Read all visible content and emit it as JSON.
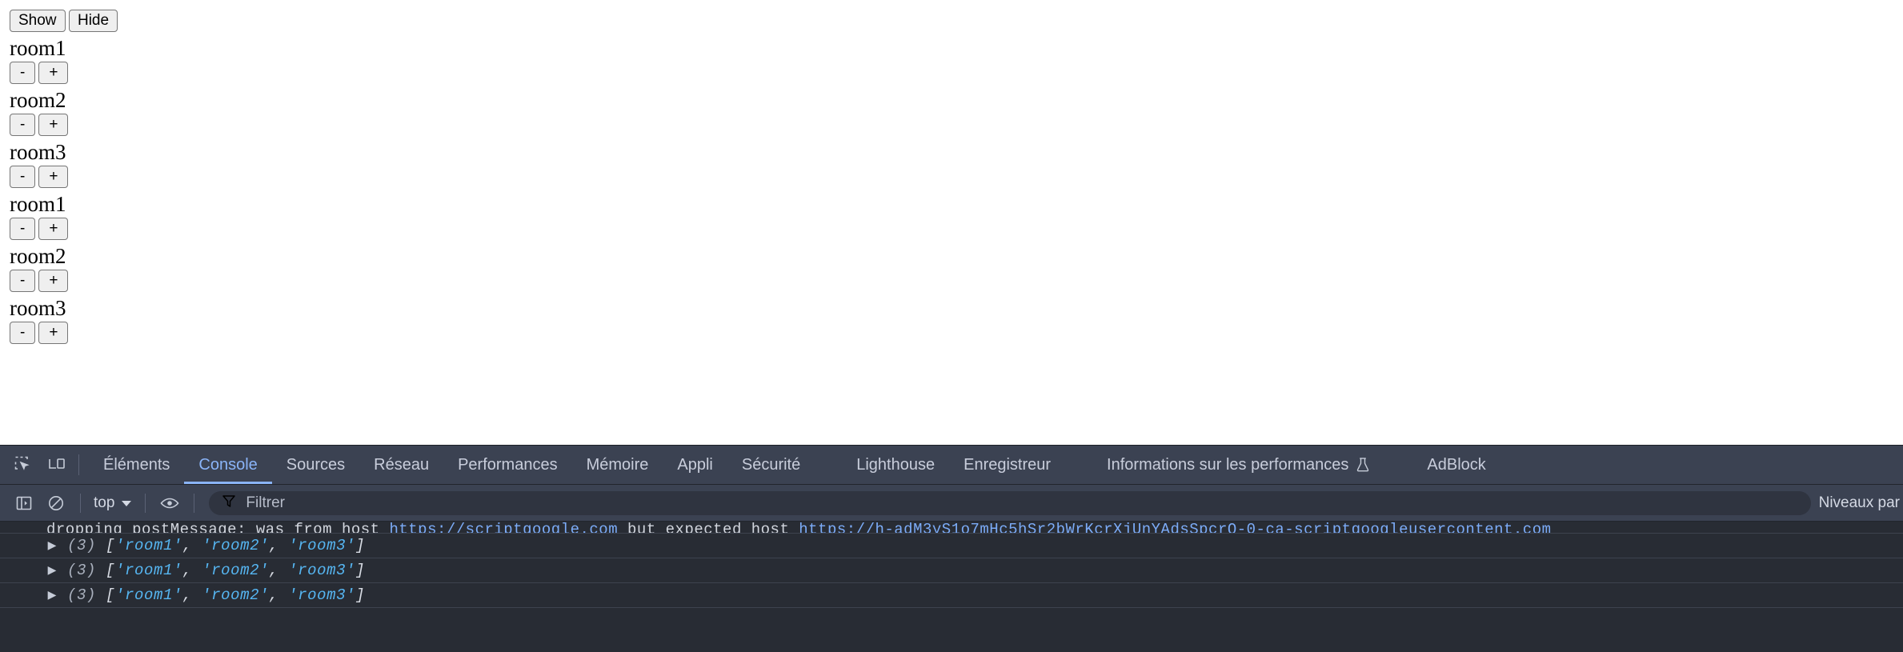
{
  "page": {
    "top_buttons": [
      {
        "label": "Show",
        "name": "show-button"
      },
      {
        "label": "Hide",
        "name": "hide-button"
      }
    ],
    "decrement_label": "-",
    "increment_label": "+",
    "rooms": [
      {
        "label": "room1"
      },
      {
        "label": "room2"
      },
      {
        "label": "room3"
      },
      {
        "label": "room1"
      },
      {
        "label": "room2"
      },
      {
        "label": "room3"
      }
    ]
  },
  "devtools": {
    "tabs": [
      {
        "label": "Éléments",
        "active": false
      },
      {
        "label": "Console",
        "active": true
      },
      {
        "label": "Sources",
        "active": false
      },
      {
        "label": "Réseau",
        "active": false
      },
      {
        "label": "Performances",
        "active": false
      },
      {
        "label": "Mémoire",
        "active": false
      },
      {
        "label": "Appli",
        "active": false
      },
      {
        "label": "Sécurité",
        "active": false
      },
      {
        "label": "Lighthouse",
        "active": false
      },
      {
        "label": "Enregistreur",
        "active": false
      },
      {
        "label": "Informations sur les performances",
        "active": false,
        "icon": "flask-icon"
      },
      {
        "label": "AdBlock",
        "active": false
      }
    ],
    "console_toolbar": {
      "context_value": "top",
      "filter_placeholder": "Filtrer",
      "levels_label": "Niveaux par"
    },
    "console_rows": [
      {
        "type": "clipped-warning",
        "text_before": "dropping postMessage: was from host ",
        "link1": "https://scriptgoogle.com",
        "text_middle": " but expected host ",
        "link2": "https://h-adM3yS1o7mHc5hSr2bWrKcrXjUnYAdsSpcrQ-0-ca-scriptgoogleusercontent.com"
      },
      {
        "type": "array",
        "count": "(3)",
        "open": "[",
        "items": [
          "'room1'",
          "'room2'",
          "'room3'"
        ],
        "sep": ", ",
        "close": "]"
      },
      {
        "type": "array",
        "count": "(3)",
        "open": "[",
        "items": [
          "'room1'",
          "'room2'",
          "'room3'"
        ],
        "sep": ", ",
        "close": "]"
      },
      {
        "type": "array",
        "count": "(3)",
        "open": "[",
        "items": [
          "'room1'",
          "'room2'",
          "'room3'"
        ],
        "sep": ", ",
        "close": "]"
      }
    ],
    "icons": {
      "inspect": "inspect-element-icon",
      "device": "device-toolbar-icon",
      "sidebar": "console-sidebar-icon",
      "clear": "clear-console-icon",
      "eye": "live-expression-icon",
      "filter": "filter-icon",
      "chevron": "chevron-down-icon"
    },
    "colors": {
      "accent": "#8ab4f8",
      "tabbar_bg": "#3b4252",
      "console_bg": "#282c34",
      "string": "#56b6f2"
    }
  }
}
